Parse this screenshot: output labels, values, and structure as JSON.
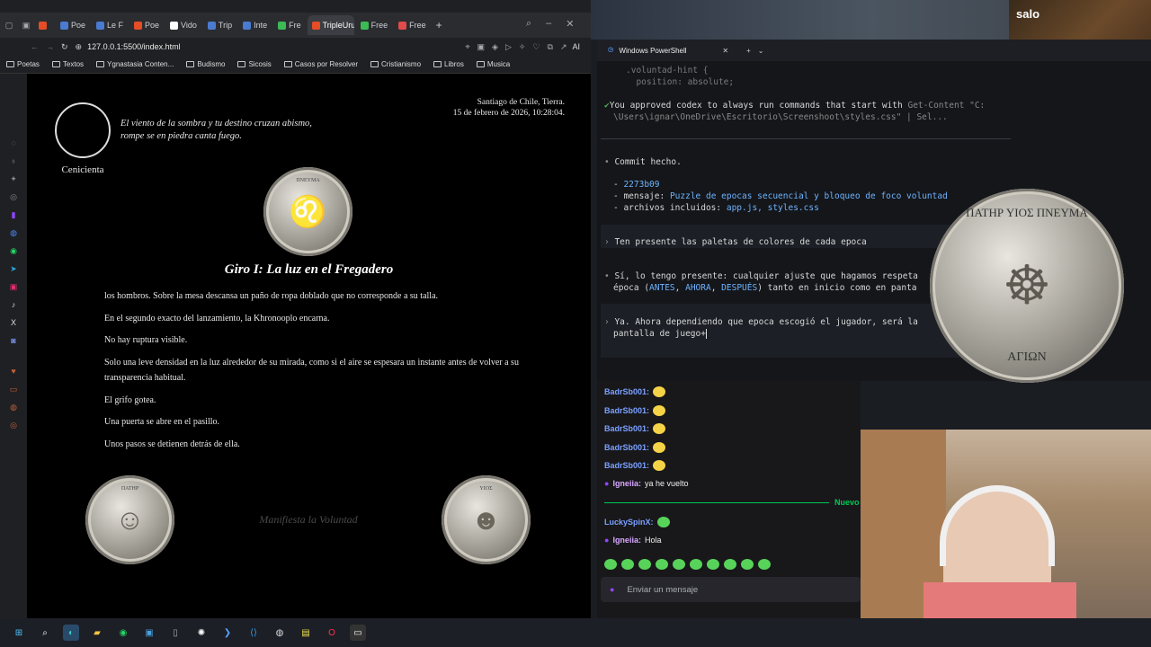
{
  "browser": {
    "tabs": [
      {
        "label": "",
        "color": "#e44d26"
      },
      {
        "label": "Poe",
        "color": "#4a7bd0"
      },
      {
        "label": "Le F",
        "color": "#4a7bd0"
      },
      {
        "label": "Poe",
        "color": "#e44d26"
      },
      {
        "label": "Vido",
        "color": "#ffffff"
      },
      {
        "label": "Trip",
        "color": "#4a7bd0"
      },
      {
        "label": "Inte",
        "color": "#4a7bd0"
      },
      {
        "label": "Fre",
        "color": "#3cba54"
      },
      {
        "label": "TripleUru",
        "color": "#e44d26",
        "active": true
      },
      {
        "label": "Free",
        "color": "#3cba54"
      },
      {
        "label": "Free",
        "color": "#e04b4b"
      }
    ],
    "url": "127.0.0.1:5500/index.html",
    "addr_ai": "AI",
    "bookmarks": [
      "Poetas",
      "Textos",
      "Ygnastasia Conten...",
      "Budismo",
      "Sicosis",
      "Casos por Resolver",
      "Cristianismo",
      "Libros",
      "Musica"
    ]
  },
  "page": {
    "avatar_name": "Cenicienta",
    "quote": [
      "El viento de la sombra y tu destino cruzan abismo,",
      "rompe se en piedra canta fuego."
    ],
    "location": "Santiago de Chile, Tierra.",
    "datetime": "15 de febrero de 2026, 10:28:04.",
    "title": "Giro I: La luz en el Fregadero",
    "paragraphs": [
      "los hombros. Sobre la mesa descansa un paño de ropa doblado que no corresponde a su talla.",
      "En el segundo exacto del lanzamiento, la Khronooplo encarna.",
      "No hay ruptura visible.",
      "Solo una leve densidad en la luz alrededor de su mirada, como si el aire se espesara un instante antes de volver a su transparencia habitual.",
      "El grifo gotea.",
      "Una puerta se abre en el pasillo.",
      "Unos pasos se detienen detrás de ella."
    ],
    "voluntad_hint": "Manifiesta la Voluntad",
    "coin_top_text": "ΠΝΕΥΜΑ",
    "coin_left_text": "ΠΑΤΗΡ",
    "coin_right_text": "ΥΙΟΣ"
  },
  "terminal": {
    "tab_title": "Windows PowerShell",
    "code_lines": [
      ".voluntad-hint {",
      "  position: absolute;"
    ],
    "approved_prefix": "You approved codex to always run commands that start with",
    "approved_cmd": "Get-Content \"C:",
    "approved_cmd2": "\\Users\\ignar\\OneDrive\\Escritorio\\Screenshoot\\styles.css\" | Sel...",
    "commit_done": "Commit hecho.",
    "commit_hash": "2273b09",
    "commit_msg_label": "mensaje:",
    "commit_msg": "Puzzle de epocas secuencial y bloqueo de foco voluntad",
    "files_label": "archivos incluidos:",
    "files": "app.js, styles.css",
    "prompt1": "Ten presente las paletas de colores de cada epoca",
    "reply1a": "Sí, lo tengo presente: cualquier ajuste que hagamos respeta",
    "reply1b_pre": "época (",
    "reply1b_antes": "ANTES",
    "reply1b_ahora": "AHORA",
    "reply1b_despues": "DESPUÉS",
    "reply1b_post": ") tanto en inicio como en panta",
    "prompt2a": "Ya. Ahora dependiendo que epoca escogió el jugador, será la",
    "prompt2b": "pantalla de juego+",
    "coin_text": "ΠΑΤΗΡ ΥΙΟΣ ΠΝΕΥΜΑ",
    "coin_bottom": "ΑΓΙΩΝ"
  },
  "chat": {
    "messages": [
      {
        "user": "BadrSb001:",
        "text": "",
        "emote": true
      },
      {
        "user": "BadrSb001:",
        "text": "",
        "emote": true
      },
      {
        "user": "BadrSb001:",
        "text": "",
        "emote": true
      },
      {
        "user": "BadrSb001:",
        "text": "",
        "emote": true
      },
      {
        "user": "BadrSb001:",
        "text": "",
        "emote": true
      },
      {
        "user": "Igneiia:",
        "text": "ya he vuelto",
        "emote": false
      }
    ],
    "new_label": "Nuevo",
    "messages2": [
      {
        "user": "LuckySpinX:",
        "text": "",
        "emote": true
      },
      {
        "user": "Igneiia:",
        "text": "Hola",
        "emote": false
      }
    ],
    "input_placeholder": "Enviar un mensaje"
  },
  "overlay": {
    "brand": "salo"
  },
  "colors": {
    "accent": "#6eb3ff",
    "chat_user": "#7aa0ff",
    "twitch_purple": "#9146ff",
    "new_green": "#00c853"
  }
}
